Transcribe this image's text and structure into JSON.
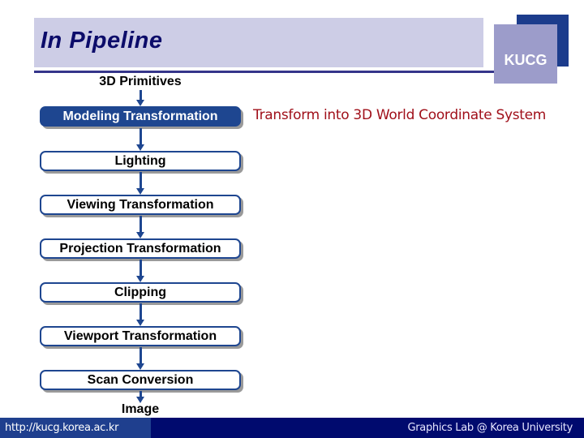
{
  "slide": {
    "title": "In Pipeline",
    "logo_text": "KUCG"
  },
  "pipeline": {
    "input_label": "3D Primitives",
    "output_label": "Image",
    "stages": [
      {
        "label": "Modeling Transformation",
        "active": true
      },
      {
        "label": "Lighting",
        "active": false
      },
      {
        "label": "Viewing Transformation",
        "active": false
      },
      {
        "label": "Projection Transformation",
        "active": false
      },
      {
        "label": "Clipping",
        "active": false
      },
      {
        "label": "Viewport Transformation",
        "active": false
      },
      {
        "label": "Scan Conversion",
        "active": false
      }
    ],
    "annotation": "Transform into 3D World Coordinate System"
  },
  "footer": {
    "url": "http://kucg.korea.ac.kr",
    "credit": "Graphics Lab @ Korea University"
  },
  "colors": {
    "title_bar": "#cdcde6",
    "title_text": "#0c0c6a",
    "node_border": "#1e4690",
    "annotation": "#a0101a",
    "footer": "#000a6e",
    "footer_left": "#1f3f8e"
  }
}
